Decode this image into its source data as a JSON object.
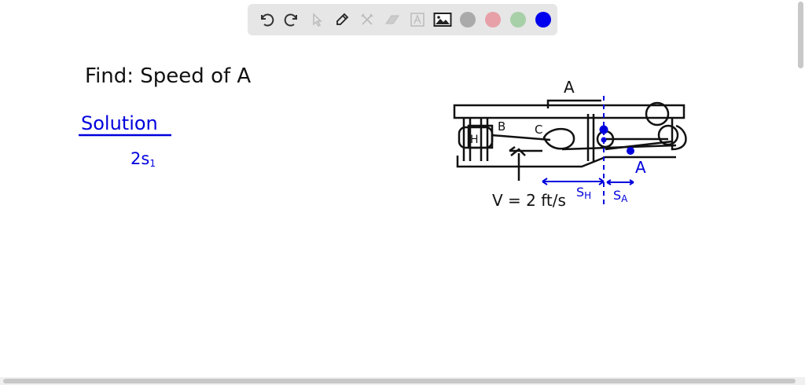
{
  "toolbar": {
    "tools": [
      "undo",
      "redo",
      "select",
      "pen",
      "tools",
      "eraser",
      "text",
      "image"
    ],
    "colors": [
      "#aaaaaa",
      "#e8a0a8",
      "#a8d0a8",
      "#0000ee"
    ],
    "selected_color": "#0000ee"
  },
  "notes": {
    "find": "Find:  Speed of A",
    "solution": "Solution",
    "partial": "2s",
    "partial_sub": "1"
  },
  "diagram": {
    "label_a_top": "A",
    "label_b": "B",
    "label_c": "C",
    "label_h": "H",
    "label_a_blue": "A",
    "velocity": "V = 2 ft/s",
    "s_h": "S",
    "s_h_sub": "H",
    "s_a": "S",
    "s_a_sub": "A"
  }
}
